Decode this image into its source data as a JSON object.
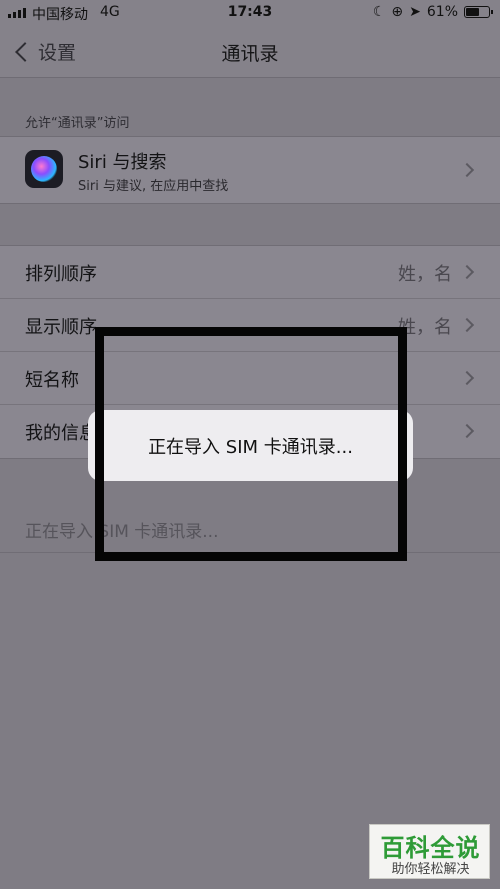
{
  "status_bar": {
    "carrier": "中国移动",
    "network": "4G",
    "time": "17:43",
    "battery_percent": "61%",
    "battery_level": 0.61,
    "icons": [
      "moon-icon",
      "orientation-lock-icon",
      "location-icon"
    ]
  },
  "nav": {
    "back_label": "设置",
    "title": "通讯录"
  },
  "access_section": {
    "header": "允许“通讯录”访问",
    "siri": {
      "title": "Siri 与搜索",
      "subtitle": "Siri 与建议, 在应用中查找"
    }
  },
  "settings_rows": [
    {
      "label": "排列顺序",
      "value": "姓，名"
    },
    {
      "label": "显示顺序",
      "value": "姓，名"
    },
    {
      "label": "短名称",
      "value": ""
    },
    {
      "label": "我的信息",
      "value": ""
    }
  ],
  "import_row": {
    "label": "正在导入 SIM 卡通讯录..."
  },
  "alert": {
    "message": "正在导入 SIM 卡通讯录..."
  },
  "watermark": {
    "main": "百科全说",
    "sub": "助你轻松解决"
  },
  "colors": {
    "dim_background": "#7f7c84",
    "alert_background": "#eeedf0",
    "annotation_border": "#050505",
    "watermark_green": "#2e9b37"
  }
}
